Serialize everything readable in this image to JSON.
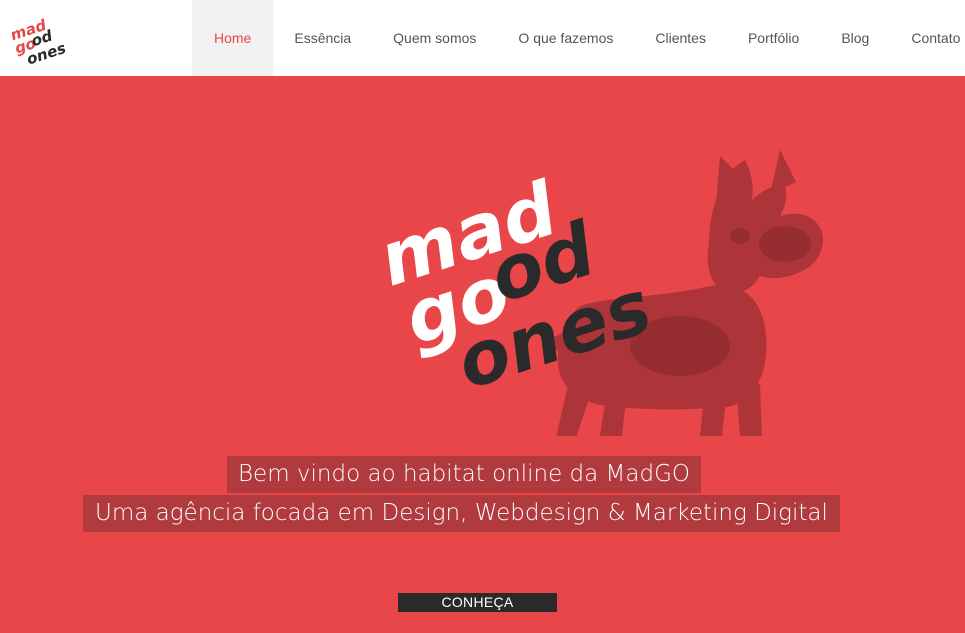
{
  "brand": {
    "logo_lines": [
      "mad",
      "go",
      "od",
      "ones"
    ],
    "accent": "#e84649",
    "dark": "#2a2a2a"
  },
  "nav": {
    "items": [
      {
        "label": "Home",
        "active": true
      },
      {
        "label": "Essência"
      },
      {
        "label": "Quem somos"
      },
      {
        "label": "O que fazemos"
      },
      {
        "label": "Clientes"
      },
      {
        "label": "Portfólio"
      },
      {
        "label": "Blog"
      },
      {
        "label": "Contato"
      }
    ]
  },
  "hero": {
    "background": "#e84649",
    "logo_lines": [
      "mad",
      "go",
      "od",
      "ones"
    ],
    "image": "french-bulldog",
    "headline": "Bem vindo ao habitat online da MadGO",
    "subheadline": "Uma agência focada em Design, Webdesign & Marketing Digital",
    "cta_label": "CONHEÇA"
  }
}
